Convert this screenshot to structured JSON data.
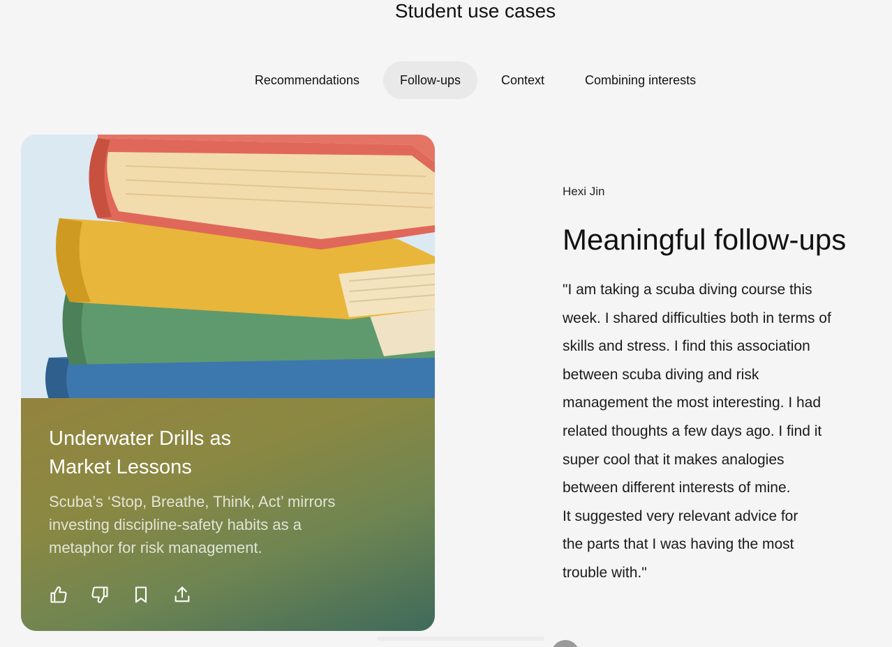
{
  "section": {
    "title": "Student use cases"
  },
  "tabs": [
    {
      "label": "Recommendations",
      "active": false
    },
    {
      "label": "Follow-ups",
      "active": true
    },
    {
      "label": "Context",
      "active": false
    },
    {
      "label": "Combining interests",
      "active": false
    }
  ],
  "card": {
    "title_line1": "Underwater Drills as",
    "title_line2": "Market Lessons",
    "description_line1": "Scuba’s ‘Stop, Breathe, Think, Act’ mirrors",
    "description_line2": "investing discipline-safety habits as a",
    "description_line3": "metaphor for risk management.",
    "actions": [
      "thumbs-up-icon",
      "thumbs-down-icon",
      "bookmark-icon",
      "share-icon"
    ],
    "image": "stack-of-books-illustration"
  },
  "testimonial": {
    "author": "Hexi Jin",
    "heading": "Meaningful follow-ups",
    "quote_lines": [
      "\"I am taking a scuba diving course this",
      "week. I shared difficulties both in terms of",
      "skills and stress. I find this association",
      "between scuba diving and risk",
      "management the most interesting. I had",
      "related thoughts a few days ago. I find it",
      "super cool that it makes analogies",
      "between different interests of mine.",
      "It suggested very relevant advice for",
      "the parts that I was having the most",
      "trouble with.\""
    ]
  },
  "colors": {
    "background": "#f5f5f5",
    "active_tab": "#e9e9e9",
    "card_panel_start": "#93843f",
    "card_panel_end": "#3f6a5b"
  }
}
